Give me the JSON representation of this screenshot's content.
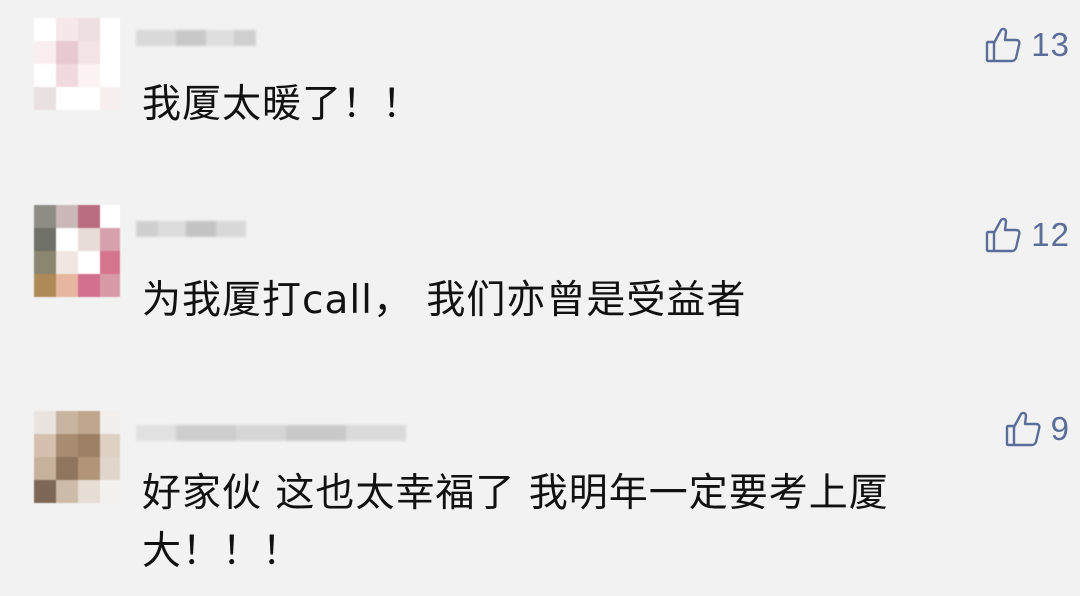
{
  "comments": [
    {
      "author": "",
      "text": "我厦太暖了！！",
      "likes": "13",
      "avatar_palette": [
        "#ffffff",
        "#f6e7ea",
        "#eedfe2",
        "#ffffff",
        "#f9eef0",
        "#e7c9cf",
        "#f3e3e6",
        "#ffffff",
        "#ffffff",
        "#f1dadd",
        "#fbf2f3",
        "#ffffff",
        "#e9e0e1",
        "#ffffff",
        "#ffffff",
        "#f7eef0"
      ]
    },
    {
      "author": "",
      "text": "为我厦打call， 我们亦曾是受益者",
      "likes": "12",
      "avatar_palette": [
        "#8d8d85",
        "#c9b8b7",
        "#b96c7f",
        "#ffffff",
        "#6f7068",
        "#ffffff",
        "#e8dcd8",
        "#d6a0ac",
        "#8a8670",
        "#f1e7e2",
        "#ffffff",
        "#d4748d",
        "#ad8a58",
        "#e7b6a0",
        "#d26f8e",
        "#d99aa8"
      ]
    },
    {
      "author": "",
      "text": "好家伙 这也太幸福了 我明年一定要考上厦大！！！",
      "likes": "9",
      "avatar_palette": [
        "#e9e4e0",
        "#c9b4a0",
        "#bfa58c",
        "#f1eeeb",
        "#d5c0ad",
        "#a98b72",
        "#9d7f66",
        "#ded0c3",
        "#c8b19b",
        "#8f745e",
        "#b29479",
        "#e1d6cc",
        "#7d6756",
        "#cdbbaa",
        "#e6ddd4",
        "#f3f0ed"
      ]
    }
  ],
  "colors": {
    "background": "#f2f2f2",
    "accent": "#5b6d99",
    "text": "#111111"
  },
  "icons": {
    "like": "thumbs-up-icon"
  }
}
